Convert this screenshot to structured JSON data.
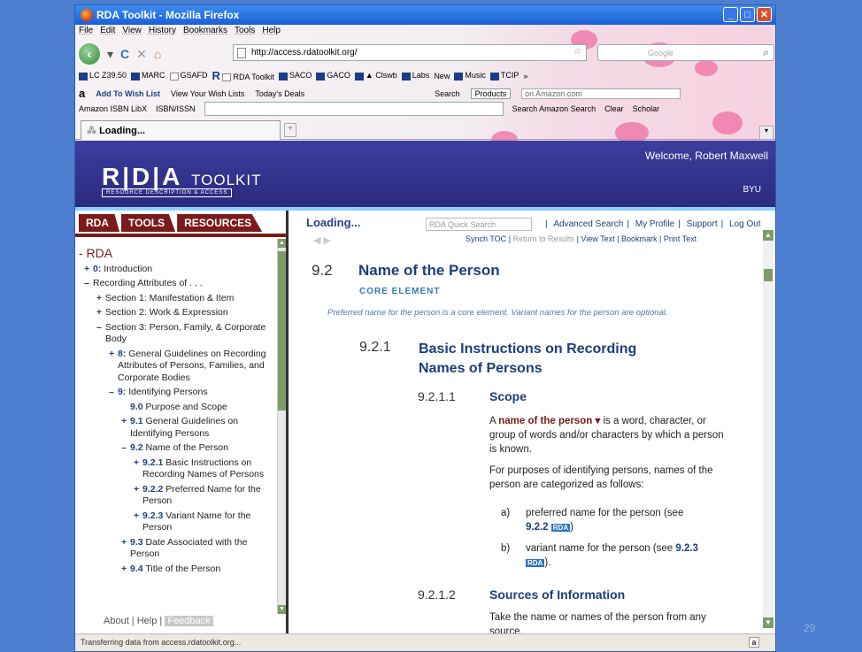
{
  "window": {
    "title": "RDA Toolkit - Mozilla Firefox"
  },
  "menu": [
    "File",
    "Edit",
    "View",
    "History",
    "Bookmarks",
    "Tools",
    "Help"
  ],
  "nav": {
    "url": "http://access.rdatoolkit.org/",
    "search_placeholder": "Google"
  },
  "bookmarks": [
    "LC Z39.50",
    "MARC",
    "GSAFD",
    "RDA Toolkit",
    "SACO",
    "GACO",
    "Clswb",
    "Labs",
    "New",
    "Music",
    "TCIP"
  ],
  "amazon": {
    "wish": "Add To Wish List",
    "view": "View Your Wish Lists",
    "deals": "Today's Deals",
    "search_label": "Search",
    "products": "Products",
    "domain": "on Amazon.com"
  },
  "libx": {
    "label": "Amazon ISBN LibX",
    "isbn": "ISBN/ISSN",
    "search_amazon": "Search Amazon Search",
    "clear": "Clear",
    "scholar": "Scholar"
  },
  "tab": {
    "label": "Loading..."
  },
  "header": {
    "logo_main": "R|D|A",
    "logo_sub": "TOOLKIT",
    "tagline": "RESOURCE DESCRIPTION & ACCESS",
    "welcome": "Welcome, Robert Maxwell",
    "org": "BYU"
  },
  "left_tabs": [
    "RDA",
    "TOOLS",
    "RESOURCES"
  ],
  "tree_root": "- RDA",
  "tree": [
    {
      "pm": "+",
      "num": "0:",
      "label": "Introduction",
      "indent": 6
    },
    {
      "pm": "–",
      "num": "",
      "label": "Recording Attributes of . . .",
      "indent": 6
    },
    {
      "pm": "+",
      "num": "",
      "label": "Section 1: Manifestation & Item",
      "indent": 20
    },
    {
      "pm": "+",
      "num": "",
      "label": "Section 2: Work & Expression",
      "indent": 20
    },
    {
      "pm": "–",
      "num": "",
      "label": "Section 3: Person, Family, & Corporate Body",
      "indent": 20
    },
    {
      "pm": "+",
      "num": "8:",
      "label": "General Guidelines on Recording Attributes of Persons, Families, and Corporate Bodies",
      "indent": 34
    },
    {
      "pm": "–",
      "num": "9:",
      "label": "Identifying Persons",
      "indent": 34
    },
    {
      "pm": "",
      "num": "9.0",
      "label": "Purpose and Scope",
      "indent": 48
    },
    {
      "pm": "+",
      "num": "9.1",
      "label": "General Guidelines on Identifying Persons",
      "indent": 48
    },
    {
      "pm": "–",
      "num": "9.2",
      "label": "Name of the Person",
      "indent": 48
    },
    {
      "pm": "+",
      "num": "9.2.1",
      "label": "Basic Instructions on Recording Names of Persons",
      "indent": 62
    },
    {
      "pm": "+",
      "num": "9.2.2",
      "label": "Preferred Name for the Person",
      "indent": 62
    },
    {
      "pm": "+",
      "num": "9.2.3",
      "label": "Variant Name for the Person",
      "indent": 62
    },
    {
      "pm": "+",
      "num": "9.3",
      "label": "Date Associated with the Person",
      "indent": 48
    },
    {
      "pm": "+",
      "num": "9.4",
      "label": "Title of the Person",
      "indent": 48
    }
  ],
  "left_footer": {
    "about": "About",
    "help": "Help",
    "feedback": "Feedback"
  },
  "right_top": {
    "loading": "Loading...",
    "search_placeholder": "RDA Quick Search",
    "links": [
      "Advanced Search",
      "My Profile",
      "Support",
      "Log Out"
    ]
  },
  "toolbar": {
    "synch": "Synch TOC",
    "return": "Return to Results",
    "view": "View Text",
    "bookmark": "Bookmark",
    "print": "Print Text"
  },
  "doc": {
    "s1_num": "9.2",
    "s1_title": "Name of the Person",
    "core": "CORE ELEMENT",
    "pref": "Preferred name for the person is a core element. Variant names for the person are optional.",
    "s2_num": "9.2.1",
    "s2_title": "Basic Instructions on Recording Names of Persons",
    "s3_num": "9.2.1.1",
    "s3_title": "Scope",
    "scope_a": "A ",
    "scope_term": "name of the person ▾",
    "scope_b": " is a word, character, or group of words and/or characters by which a person is known.",
    "scope_p2": "For purposes of identifying persons, names of the person are categorized as follows:",
    "item_a_letter": "a)",
    "item_a_text": "preferred name for the person (see ",
    "item_a_ref": "9.2.2",
    "item_b_letter": "b)",
    "item_b_text": "variant name for the person (see ",
    "item_b_ref": "9.2.3",
    "rda_badge": "RDA",
    "s4_num": "9.2.1.2",
    "s4_title": "Sources of Information",
    "sources_p": "Take the name or names of the person from any source."
  },
  "status": "Transferring data from access.rdatoolkit.org...",
  "slide_number": "29"
}
